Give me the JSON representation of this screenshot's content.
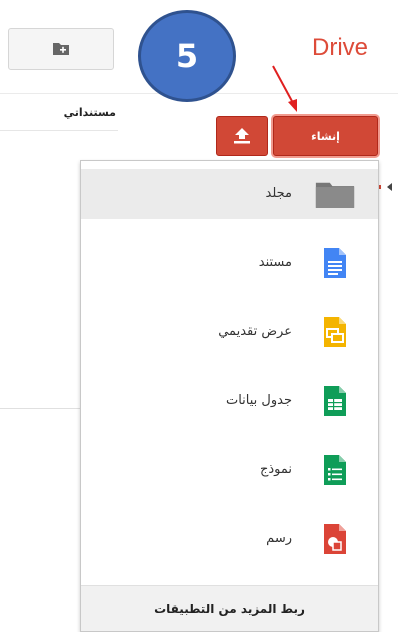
{
  "header": {
    "drive_label": "Drive",
    "step_number": "5"
  },
  "toolbar": {
    "create_label": "إنشاء",
    "accent_color": "#d14836"
  },
  "sidebar": {
    "my_drive_label": "مستنداتي"
  },
  "menu": {
    "items": [
      {
        "label": "مجلد",
        "icon": "folder-icon"
      },
      {
        "label": "مستند",
        "icon": "document-icon"
      },
      {
        "label": "عرض تقديمي",
        "icon": "presentation-icon"
      },
      {
        "label": "جدول بيانات",
        "icon": "spreadsheet-icon"
      },
      {
        "label": "نموذج",
        "icon": "form-icon"
      },
      {
        "label": "رسم",
        "icon": "drawing-icon"
      }
    ],
    "footer_label": "ربط المزيد من التطبيقات"
  }
}
